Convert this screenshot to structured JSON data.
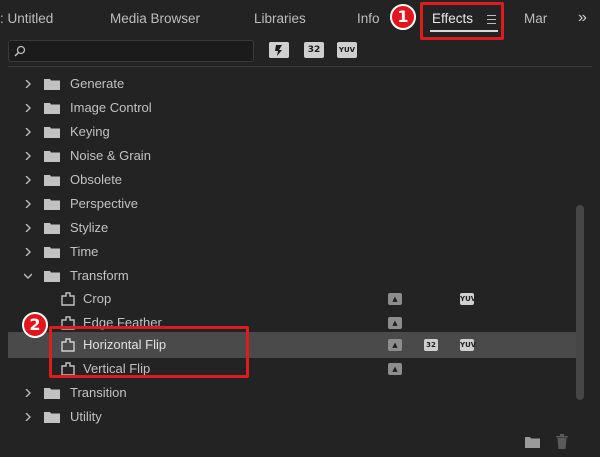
{
  "tabs": [
    {
      "label": ": Untitled"
    },
    {
      "label": "Media Browser"
    },
    {
      "label": "Libraries"
    },
    {
      "label": "Info"
    },
    {
      "label": "Effects"
    },
    {
      "label": "Mar"
    }
  ],
  "annotations": {
    "step1": "1",
    "step2": "2"
  },
  "search": {
    "value": "",
    "placeholder": ""
  },
  "filters": {
    "accelerated": "",
    "bit32": "32",
    "yuv": "YUV"
  },
  "tree": {
    "folders_top": [
      {
        "label": "Generate"
      },
      {
        "label": "Image Control"
      },
      {
        "label": "Keying"
      },
      {
        "label": "Noise & Grain"
      },
      {
        "label": "Obsolete"
      },
      {
        "label": "Perspective"
      },
      {
        "label": "Stylize"
      },
      {
        "label": "Time"
      },
      {
        "label": "Transform"
      }
    ],
    "effects": [
      {
        "label": "Crop"
      },
      {
        "label": "Edge Feather"
      },
      {
        "label": "Horizontal Flip"
      },
      {
        "label": "Vertical Flip"
      }
    ],
    "folders_bottom": [
      {
        "label": "Transition"
      },
      {
        "label": "Utility"
      }
    ]
  },
  "colors": {
    "accent_red": "#e01b1b",
    "selected_row": "#4a4a4a",
    "panel_bg": "#232323"
  }
}
